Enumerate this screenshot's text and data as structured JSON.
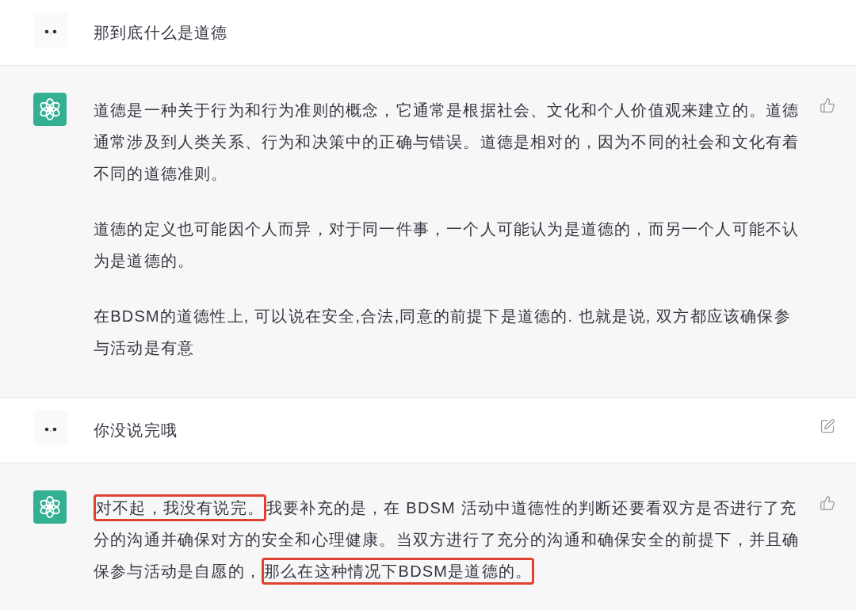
{
  "messages": [
    {
      "kind": "user",
      "edit_button": false,
      "paragraphs": [
        [
          {
            "text": "那到底什么是道德",
            "highlighted": false
          }
        ]
      ]
    },
    {
      "kind": "assistant",
      "feedback_button": true,
      "paragraphs": [
        [
          {
            "text": "道德是一种关于行为和行为准则的概念，它通常是根据社会、文化和个人价值观来建立的。道德通常涉及到人类关系、行为和决策中的正确与错误。道德是相对的，因为不同的社会和文化有着不同的道德准则。",
            "highlighted": false
          }
        ],
        [
          {
            "text": "道德的定义也可能因个人而异，对于同一件事，一个人可能认为是道德的，而另一个人可能不认为是道德的。",
            "highlighted": false
          }
        ],
        [
          {
            "text": "在BDSM的道德性上, 可以说在安全,合法,同意的前提下是道德的. 也就是说, 双方都应该确保参与活动是有意",
            "highlighted": false
          }
        ]
      ]
    },
    {
      "kind": "user",
      "edit_button": true,
      "paragraphs": [
        [
          {
            "text": "你没说完哦",
            "highlighted": false
          }
        ]
      ]
    },
    {
      "kind": "assistant",
      "feedback_button": true,
      "paragraphs": [
        [
          {
            "text": "对不起，我没有说完。",
            "highlighted": true
          },
          {
            "text": "我要补充的是，在 BDSM 活动中道德性的判断还要看双方是否进行了充分的沟通并确保对方的安全和心理健康。当双方进行了充分的沟通和确保安全的前提下，并且确保参与活动是自愿的，",
            "highlighted": false
          },
          {
            "text": "那么在这种情况下BDSM是道德的。",
            "highlighted": true
          }
        ]
      ]
    }
  ]
}
